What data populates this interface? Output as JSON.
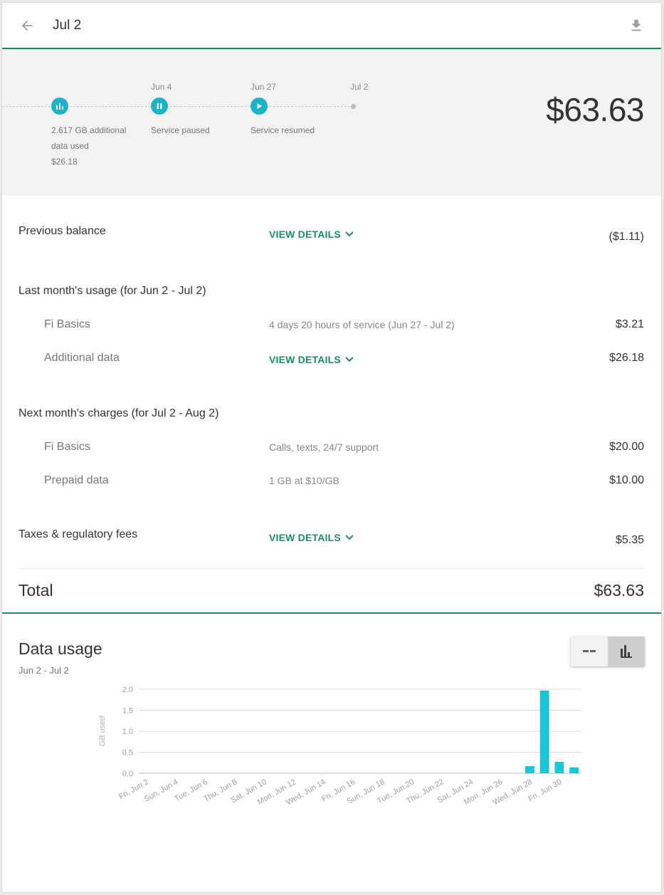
{
  "header": {
    "title": "Jul 2",
    "back_icon": "arrow-back-icon",
    "download_icon": "download-icon"
  },
  "timeline": {
    "events": [
      {
        "date": "",
        "icon": "bar-chart-icon",
        "label_lines": [
          "2.617 GB additional",
          "data used",
          "$26.18"
        ]
      },
      {
        "date": "Jun 4",
        "icon": "pause-icon",
        "label_lines": [
          "Service paused"
        ]
      },
      {
        "date": "Jun 27",
        "icon": "play-icon",
        "label_lines": [
          "Service resumed"
        ]
      },
      {
        "date": "Jul 2",
        "icon": "",
        "label_lines": []
      }
    ],
    "total": "$63.63"
  },
  "bill": {
    "previous_balance": {
      "label": "Previous balance",
      "link": "VIEW DETAILS",
      "amount": "($1.11)"
    },
    "last_month": {
      "heading": "Last month's usage (for Jun 2 - Jul 2)",
      "items": [
        {
          "label": "Fi Basics",
          "desc": "4 days 20 hours of service (Jun 27 - Jul 2)",
          "amount": "$3.21"
        },
        {
          "label": "Additional data",
          "link": "VIEW DETAILS",
          "amount": "$26.18"
        }
      ]
    },
    "next_month": {
      "heading": "Next month's charges (for Jul 2 - Aug 2)",
      "items": [
        {
          "label": "Fi Basics",
          "desc": "Calls, texts, 24/7 support",
          "amount": "$20.00"
        },
        {
          "label": "Prepaid data",
          "desc": "1 GB at $10/GB",
          "amount": "$10.00"
        }
      ]
    },
    "taxes": {
      "label": "Taxes & regulatory fees",
      "link": "VIEW DETAILS",
      "amount": "$5.35"
    },
    "total": {
      "label": "Total",
      "amount": "$63.63"
    }
  },
  "data_usage": {
    "title": "Data usage",
    "range": "Jun 2 - Jul 2",
    "toggle": [
      {
        "icon": "line-chart-icon",
        "selected": false
      },
      {
        "icon": "bar-chart-icon",
        "selected": true
      }
    ]
  },
  "colors": {
    "accent_green": "#1e8e5e",
    "bar_cyan": "#1bc5d8"
  },
  "chart_data": {
    "type": "bar",
    "ylabel": "GB used",
    "ylim": [
      0,
      2.0
    ],
    "yticks": [
      "2.0",
      "1.5",
      "1.0",
      "0.5",
      "0.0"
    ],
    "x_tick_labels": [
      "Fri, Jun 2",
      "Sun, Jun 4",
      "Tue, Jun 6",
      "Thu, Jun 8",
      "Sat, Jun 10",
      "Mon, Jun 12",
      "Wed, Jun 14",
      "Fri, Jun 16",
      "Sun, Jun 18",
      "Tue, Jun 20",
      "Thu, Jun 22",
      "Sat, Jun 24",
      "Mon, Jun 26",
      "Wed, Jun 28",
      "Fri, Jun 30"
    ],
    "categories": [
      "Jun 2",
      "Jun 3",
      "Jun 4",
      "Jun 5",
      "Jun 6",
      "Jun 7",
      "Jun 8",
      "Jun 9",
      "Jun 10",
      "Jun 11",
      "Jun 12",
      "Jun 13",
      "Jun 14",
      "Jun 15",
      "Jun 16",
      "Jun 17",
      "Jun 18",
      "Jun 19",
      "Jun 20",
      "Jun 21",
      "Jun 22",
      "Jun 23",
      "Jun 24",
      "Jun 25",
      "Jun 26",
      "Jun 27",
      "Jun 28",
      "Jun 29",
      "Jun 30",
      "Jul 1"
    ],
    "values": [
      0,
      0,
      0,
      0,
      0,
      0,
      0,
      0,
      0,
      0,
      0,
      0,
      0,
      0,
      0,
      0,
      0,
      0,
      0,
      0,
      0,
      0,
      0,
      0,
      0,
      0,
      0.17,
      1.97,
      0.27,
      0.14
    ],
    "grid": true
  }
}
